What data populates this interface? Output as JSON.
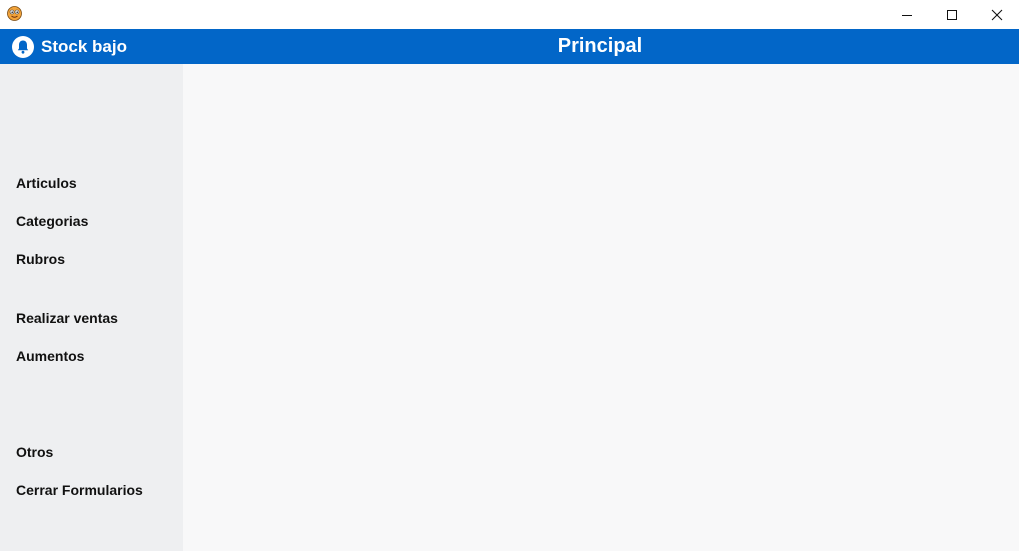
{
  "window": {
    "icons": {
      "app": "app-logo-icon",
      "minimize": "minimize-icon",
      "maximize": "maximize-icon",
      "close": "close-icon"
    }
  },
  "header": {
    "stock_label": "Stock bajo",
    "stock_icon": "bell-icon",
    "title": "Principal",
    "bg_color": "#0266c8"
  },
  "sidebar": {
    "bg_color": "#eeeff1",
    "items": [
      {
        "label": "Articulos"
      },
      {
        "label": "Categorias"
      },
      {
        "label": "Rubros"
      },
      {
        "label": "Realizar ventas"
      },
      {
        "label": "Aumentos"
      },
      {
        "label": "Otros"
      },
      {
        "label": "Cerrar Formularios"
      }
    ]
  }
}
